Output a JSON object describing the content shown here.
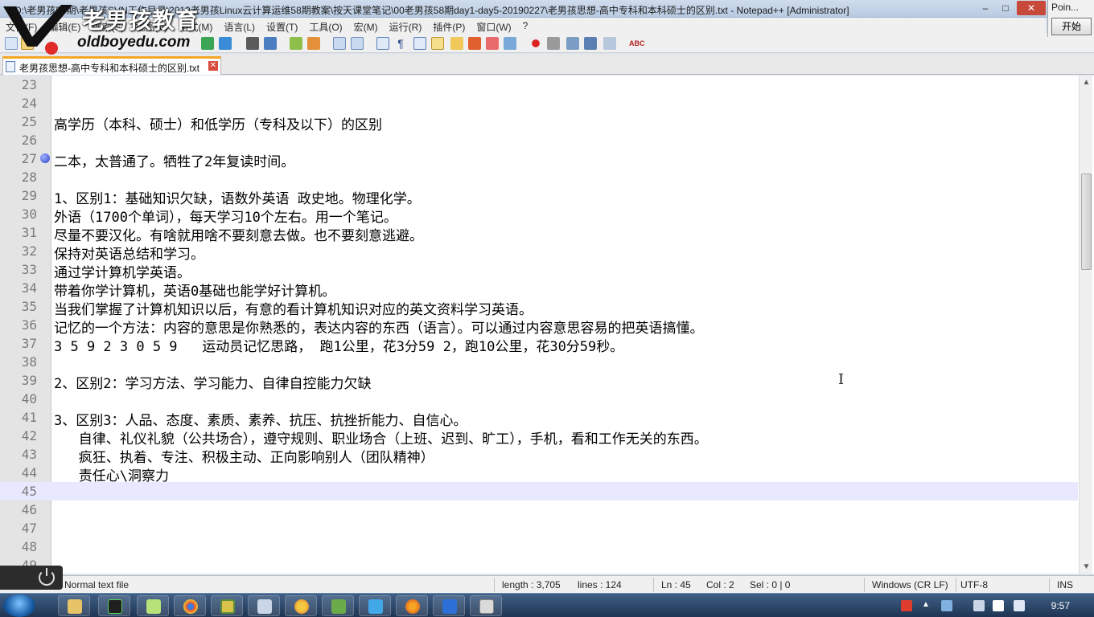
{
  "window": {
    "title": "D:\\老男孩58期\\老男孩SVN工作目录\\2019老男孩Linux云计算运维58期教案\\按天课堂笔记\\00老男孩58期day1-day5-20190227\\老男孩思想-高中专科和本科硕士的区别.txt - Notepad++ [Administrator]",
    "min": "–",
    "max": "□",
    "close": "✕"
  },
  "side_panel": {
    "title": "Poin...",
    "start_label": "开始"
  },
  "logo": {
    "brand": "老男孩教育",
    "url": "oldboyedu.com"
  },
  "menu": [
    "文件(F)",
    "编辑(E)",
    "搜索(S)",
    "视图(V)",
    "格式(M)",
    "语言(L)",
    "设置(T)",
    "工具(O)",
    "宏(M)",
    "运行(R)",
    "插件(P)",
    "窗口(W)",
    "?"
  ],
  "tab": {
    "label": "老男孩思想-高中专科和本科硕士的区别.txt",
    "close": "✕"
  },
  "editor": {
    "lines": [
      {
        "n": "23",
        "t": ""
      },
      {
        "n": "24",
        "t": ""
      },
      {
        "n": "25",
        "t": "高学历（本科、硕士）和低学历（专科及以下）的区别"
      },
      {
        "n": "26",
        "t": ""
      },
      {
        "n": "27",
        "t": "二本，太普通了。牺牲了2年复读时间。"
      },
      {
        "n": "28",
        "t": ""
      },
      {
        "n": "29",
        "t": "1、区别1：基础知识欠缺，语数外英语 政史地。物理化学。"
      },
      {
        "n": "30",
        "t": "外语（1700个单词），每天学习10个左右。用一个笔记。"
      },
      {
        "n": "31",
        "t": "尽量不要汉化。有啥就用啥不要刻意去做。也不要刻意逃避。"
      },
      {
        "n": "32",
        "t": "保持对英语总结和学习。"
      },
      {
        "n": "33",
        "t": "通过学计算机学英语。"
      },
      {
        "n": "34",
        "t": "带着你学计算机，英语0基础也能学好计算机。"
      },
      {
        "n": "35",
        "t": "当我们掌握了计算机知识以后，有意的看计算机知识对应的英文资料学习英语。"
      },
      {
        "n": "36",
        "t": "记忆的一个方法：内容的意思是你熟悉的，表达内容的东西（语言）。可以通过内容意思容易的把英语搞懂。"
      },
      {
        "n": "37",
        "t": "3 5 9 2 3 0 5 9   运动员记忆思路， 跑1公里，花3分59 2，跑10公里，花30分59秒。"
      },
      {
        "n": "38",
        "t": ""
      },
      {
        "n": "39",
        "t": "2、区别2：学习方法、学习能力、自律自控能力欠缺"
      },
      {
        "n": "40",
        "t": ""
      },
      {
        "n": "41",
        "t": "3、区别3：人品、态度、素质、素养、抗压、抗挫折能力、自信心。"
      },
      {
        "n": "42",
        "t": "   自律、礼仪礼貌（公共场合），遵守规则、职业场合（上班、迟到、旷工），手机，看和工作无关的东西。"
      },
      {
        "n": "43",
        "t": "   疯狂、执着、专注、积极主动、正向影响别人（团队精神）"
      },
      {
        "n": "44",
        "t": "   责任心\\洞察力"
      },
      {
        "n": "45",
        "t": ""
      },
      {
        "n": "46",
        "t": ""
      },
      {
        "n": "47",
        "t": ""
      },
      {
        "n": "48",
        "t": ""
      },
      {
        "n": "49",
        "t": ""
      }
    ],
    "current_line": "45",
    "bookmark_line": "27"
  },
  "status": {
    "file_type": "Normal text file",
    "length": "length : 3,705",
    "lines": "lines : 124",
    "ln": "Ln : 45",
    "col": "Col : 2",
    "sel": "Sel : 0 | 0",
    "eol": "Windows (CR LF)",
    "encoding": "UTF-8",
    "mode": "INS"
  },
  "taskbar": {
    "clock": "9:57"
  }
}
